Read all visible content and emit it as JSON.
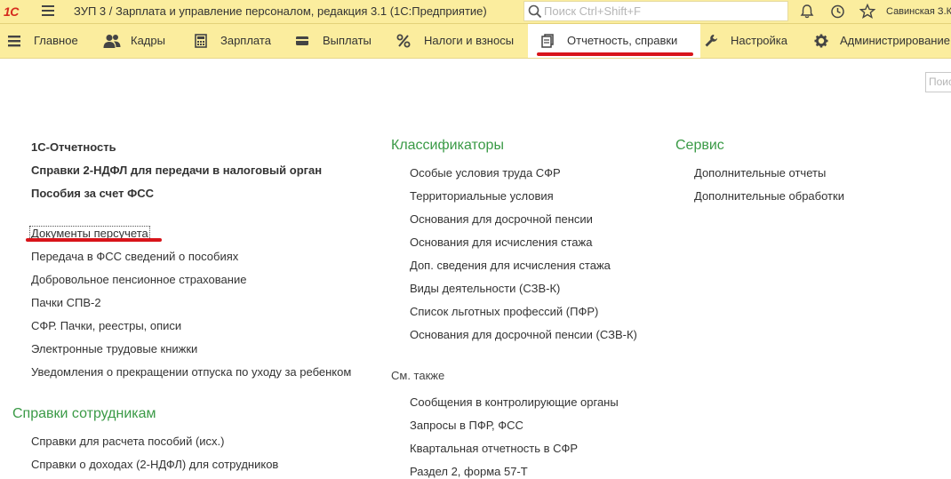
{
  "titlebar": {
    "logo_text": "1С",
    "title": "ЗУП 3 / Зарплата и управление персоналом, редакция 3.1  (1С:Предприятие)",
    "search_placeholder": "Поиск Ctrl+Shift+F",
    "user": "Савинская З.К."
  },
  "sections": [
    {
      "label": "Главное",
      "icon": "menu-lines-icon"
    },
    {
      "label": "Кадры",
      "icon": "people-icon"
    },
    {
      "label": "Зарплата",
      "icon": "calculator-icon"
    },
    {
      "label": "Выплаты",
      "icon": "wallet-icon"
    },
    {
      "label": "Налоги и взносы",
      "icon": "percent-icon"
    },
    {
      "label": "Отчетность, справки",
      "icon": "report-icon"
    },
    {
      "label": "Настройка",
      "icon": "wrench-icon"
    },
    {
      "label": "Администрирование",
      "icon": "gear-icon"
    }
  ],
  "page": {
    "search_placeholder": "Поиск",
    "col1": {
      "bold_items": [
        "1С-Отчетность",
        "Справки 2-НДФЛ для передачи в налоговый орган",
        "Пособия за счет ФСС"
      ],
      "items": [
        "Документы персучета",
        "Передача в ФСС сведений о пособиях",
        "Добровольное пенсионное страхование",
        "Пачки СПВ-2",
        "СФР. Пачки, реестры, описи",
        "Электронные трудовые книжки",
        "Уведомления о прекращении отпуска по уходу за ребенком"
      ],
      "group2_title": "Справки сотрудникам",
      "group2_items": [
        "Справки для расчета пособий (исх.)",
        "Справки о доходах (2-НДФЛ) для сотрудников"
      ]
    },
    "col2": {
      "title": "Классификаторы",
      "items": [
        "Особые условия труда СФР",
        "Территориальные условия",
        "Основания для досрочной пенсии",
        "Основания для исчисления стажа",
        "Доп. сведения для исчисления стажа",
        "Виды деятельности (СЗВ-К)",
        "Список льготных профессий (ПФР)",
        "Основания для досрочной пенсии (СЗВ-К)"
      ],
      "see_also_title": "См. также",
      "see_also_items": [
        "Сообщения в контролирующие органы",
        "Запросы в ПФР, ФСС",
        "Квартальная отчетность в СФР",
        "Раздел 2, форма 57-Т"
      ]
    },
    "col3": {
      "title": "Сервис",
      "items": [
        "Дополнительные отчеты",
        "Дополнительные обработки"
      ]
    }
  },
  "colors": {
    "bar_bg": "#fbed9e",
    "group_title": "#3a9a46",
    "highlight_red": "#d8141a",
    "logo_red": "#d52b1e"
  }
}
